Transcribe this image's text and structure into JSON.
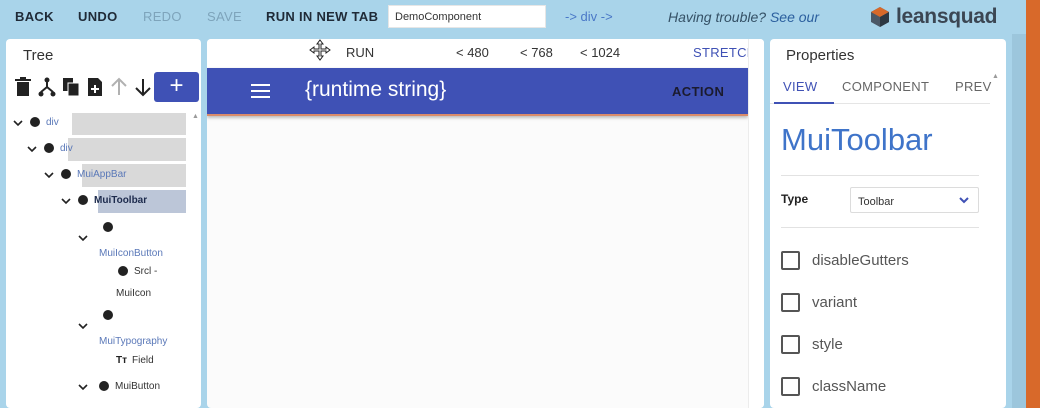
{
  "toolbar": {
    "back": "BACK",
    "undo": "UNDO",
    "redo": "REDO",
    "save": "SAVE",
    "run_new_tab": "RUN IN NEW TAB",
    "component_name": "DemoComponent",
    "path": "-> div ->",
    "help_text": "Having trouble?",
    "help_link": "See our",
    "logo": "leansquad"
  },
  "tree": {
    "title": "Tree",
    "nodes": [
      {
        "label": "div"
      },
      {
        "label": "div"
      },
      {
        "label": "MuiAppBar"
      },
      {
        "label": "MuiToolbar"
      },
      {
        "label": "MuiIconButton"
      },
      {
        "label": "Srcl -",
        "label2": "MuiIcon"
      },
      {
        "label": "MuiTypography"
      },
      {
        "label": "Field"
      },
      {
        "label": "MuiButton"
      }
    ]
  },
  "canvas": {
    "run": "RUN",
    "bp1": "< 480",
    "bp2": "< 768",
    "bp3": "< 1024",
    "stretch": "STRETCH",
    "appbar_title": "{runtime string}",
    "action": "ACTION"
  },
  "props": {
    "title": "Properties",
    "tabs": [
      "VIEW",
      "COMPONENT",
      "PREV"
    ],
    "component": "MuiToolbar",
    "type_label": "Type",
    "type_value": "Toolbar",
    "checkboxes": [
      "disableGutters",
      "variant",
      "style",
      "className"
    ]
  },
  "colors": {
    "topbar": "#a9d4ea",
    "primary": "#3f51b5",
    "accent_strip": "#d8692a"
  }
}
